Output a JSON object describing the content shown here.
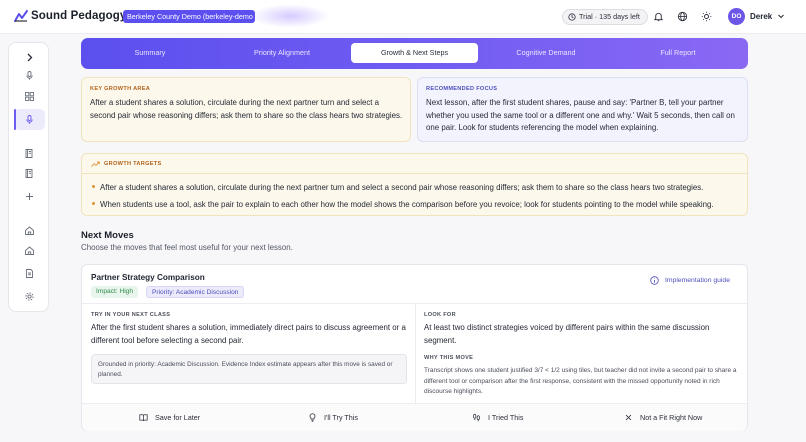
{
  "app": {
    "brand": "Sound Pedagogy",
    "demo_badge": "Berkeley County Demo (berkeley-demo",
    "trial": "Trial · 135 days left",
    "user_initials": "DO",
    "user_name": "Derek"
  },
  "tabs": [
    {
      "label": "Summary",
      "active": false
    },
    {
      "label": "Priority Alignment",
      "active": false
    },
    {
      "label": "Growth & Next Steps",
      "active": true
    },
    {
      "label": "Cognitive Demand",
      "active": false
    },
    {
      "label": "Full Report",
      "active": false
    }
  ],
  "growth_area": {
    "label": "KEY GROWTH AREA",
    "text": "After a student shares a solution, circulate during the next partner turn and select a second pair whose reasoning differs; ask them to share so the class hears two strategies."
  },
  "recommended_focus": {
    "label": "RECOMMENDED FOCUS",
    "text": "Next lesson, after the first student shares, pause and say: 'Partner B, tell your partner whether you used the same tool or a different one and why.' Wait 5 seconds, then call on one pair. Look for students referencing the model when explaining."
  },
  "growth_targets": {
    "label": "GROWTH TARGETS",
    "items": [
      "After a student shares a solution, circulate during the next partner turn and select a second pair whose reasoning differs; ask them to share so the class hears two strategies.",
      "When students use a tool, ask the pair to explain to each other how the model shows the comparison before you revoice; look for students pointing to the model while speaking."
    ]
  },
  "next_moves": {
    "title": "Next Moves",
    "subtitle": "Choose the moves that feel most useful for your next lesson."
  },
  "move": {
    "title": "Partner Strategy Comparison",
    "impact": "Impact: High",
    "priority": "Priority: Academic Discussion",
    "impl_link": "Implementation guide",
    "try_label": "TRY IN YOUR NEXT CLASS",
    "try_text": "After the first student shares a solution, immediately direct pairs to discuss agreement or a different tool before selecting a second pair.",
    "grounded": "Grounded in priority: Academic Discussion. Evidence Index estimate appears after this move is saved or planned.",
    "look_label": "LOOK FOR",
    "look_text": "At least two distinct strategies voiced by different pairs within the same discussion segment.",
    "why_label": "WHY THIS MOVE",
    "why_text": "Transcript shows one student justified 3/7 < 1/2 using tiles, but teacher did not invite a second pair to share a different tool or comparison after the first response, consistent with the missed opportunity noted in rich discourse highlights.",
    "actions": {
      "save": "Save for Later",
      "try": "I'll Try This",
      "tried": "I Tried This",
      "not_fit": "Not a Fit Right Now"
    }
  },
  "colors": {
    "accent": "#5b4fee",
    "growth_bg": "#fdf8ec",
    "focus_bg": "#f2f3fd"
  }
}
